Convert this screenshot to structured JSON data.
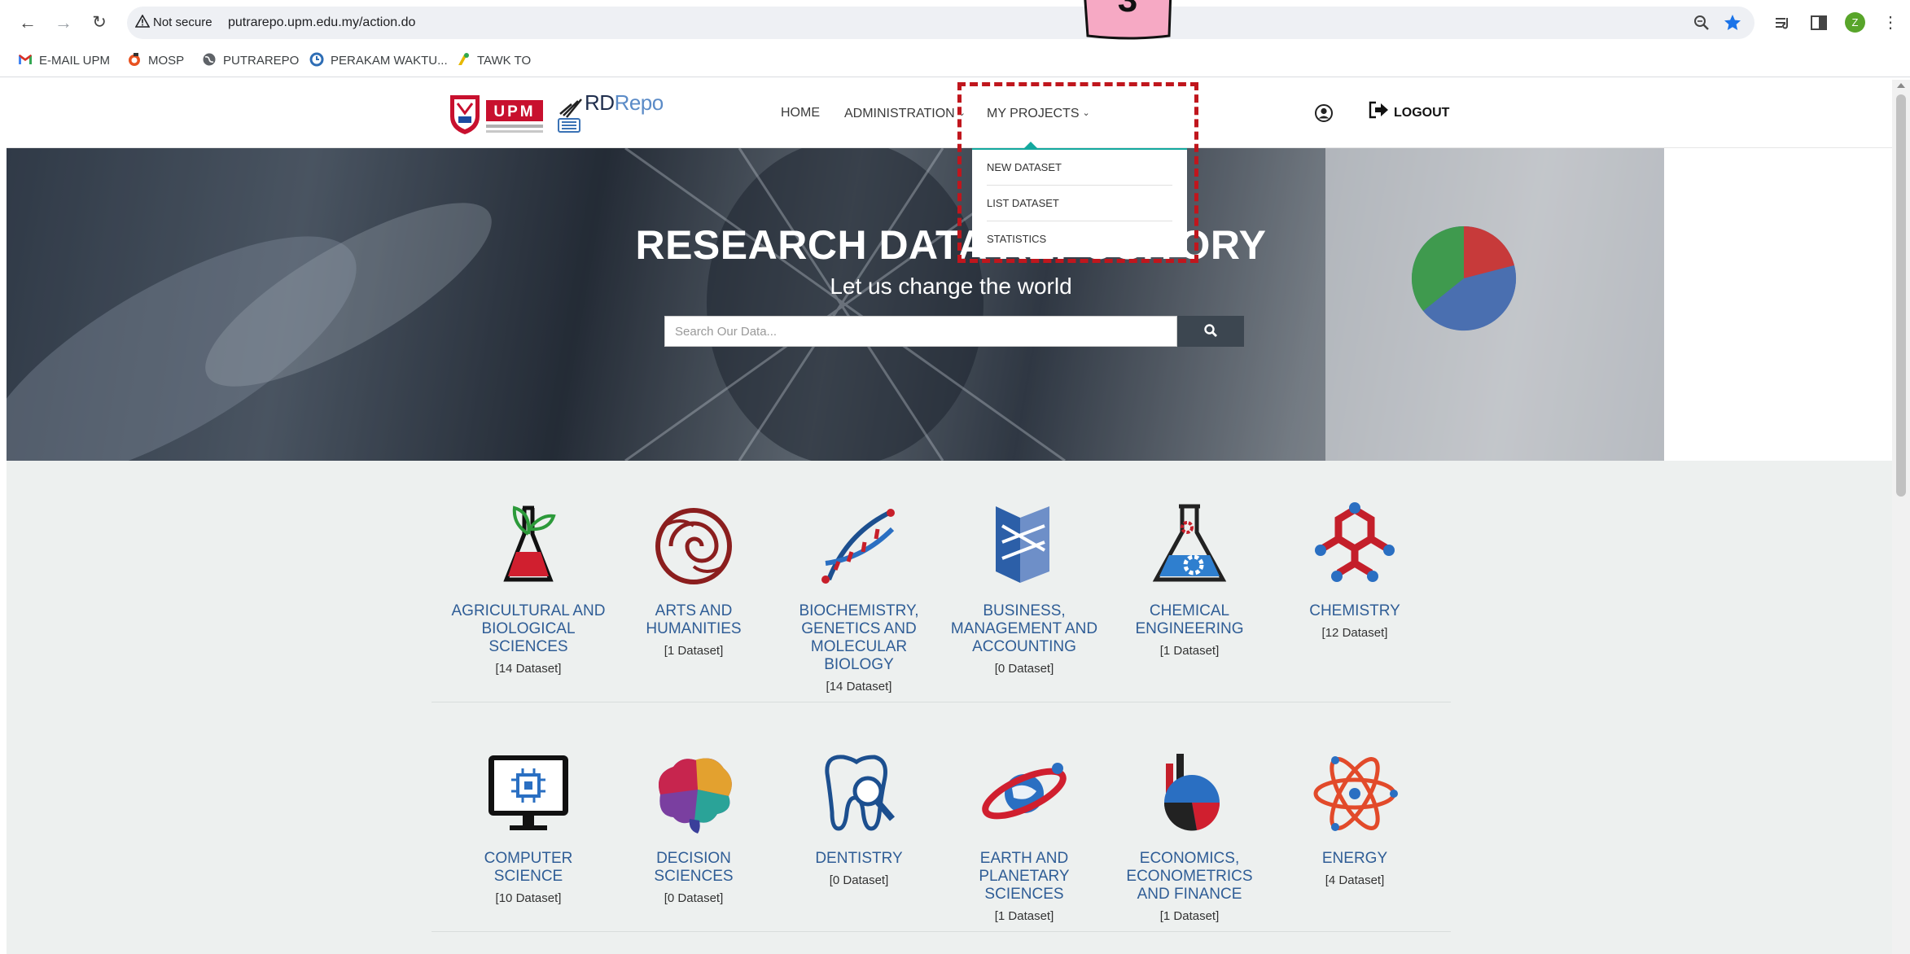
{
  "browser": {
    "security_label": "Not secure",
    "url": "putrarepo.upm.edu.my/action.do",
    "profile_initial": "Z",
    "bookmarks": [
      {
        "label": "E-MAIL UPM",
        "icon": "gmail-icon"
      },
      {
        "label": "MOSP",
        "icon": "mosp-icon"
      },
      {
        "label": "PUTRAREPO",
        "icon": "globe-icon"
      },
      {
        "label": "PERAKAM WAKTU...",
        "icon": "clock-app-icon"
      },
      {
        "label": "TAWK TO",
        "icon": "tawkto-icon"
      }
    ]
  },
  "header": {
    "logo_rd": "RD",
    "logo_repo": "Repo",
    "nav": {
      "home": "HOME",
      "administration": "ADMINISTRATION",
      "my_projects": "MY PROJECTS"
    },
    "logout": "LOGOUT"
  },
  "dropdown": {
    "items": [
      "NEW DATASET",
      "LIST DATASET",
      "STATISTICS"
    ]
  },
  "annotation": {
    "step_number": "3",
    "color": "#c0161d"
  },
  "hero": {
    "title": "RESEARCH DATA REPOSITORY",
    "subtitle": "Let us change the world",
    "search_placeholder": "Search Our Data..."
  },
  "categories": [
    {
      "name": "AGRICULTURAL AND BIOLOGICAL SCIENCES",
      "count": "[14 Dataset]",
      "icon": "plant-flask-icon"
    },
    {
      "name": "ARTS AND HUMANITIES",
      "count": "[1 Dataset]",
      "icon": "ornament-icon"
    },
    {
      "name": "BIOCHEMISTRY, GENETICS AND MOLECULAR BIOLOGY",
      "count": "[14 Dataset]",
      "icon": "dna-icon"
    },
    {
      "name": "BUSINESS, MANAGEMENT AND ACCOUNTING",
      "count": "[0 Dataset]",
      "icon": "business-icon"
    },
    {
      "name": "CHEMICAL ENGINEERING",
      "count": "[1 Dataset]",
      "icon": "flask-gear-icon"
    },
    {
      "name": "CHEMISTRY",
      "count": "[12 Dataset]",
      "icon": "molecule-icon"
    },
    {
      "name": "COMPUTER SCIENCE",
      "count": "[10 Dataset]",
      "icon": "computer-chip-icon"
    },
    {
      "name": "DECISION SCIENCES",
      "count": "[0 Dataset]",
      "icon": "brain-icon"
    },
    {
      "name": "DENTISTRY",
      "count": "[0 Dataset]",
      "icon": "tooth-icon"
    },
    {
      "name": "EARTH AND PLANETARY SCIENCES",
      "count": "[1 Dataset]",
      "icon": "planet-icon"
    },
    {
      "name": "ECONOMICS, ECONOMETRICS AND FINANCE",
      "count": "[1 Dataset]",
      "icon": "pie-chart-icon"
    },
    {
      "name": "ENERGY",
      "count": "[4 Dataset]",
      "icon": "atom-icon"
    }
  ]
}
